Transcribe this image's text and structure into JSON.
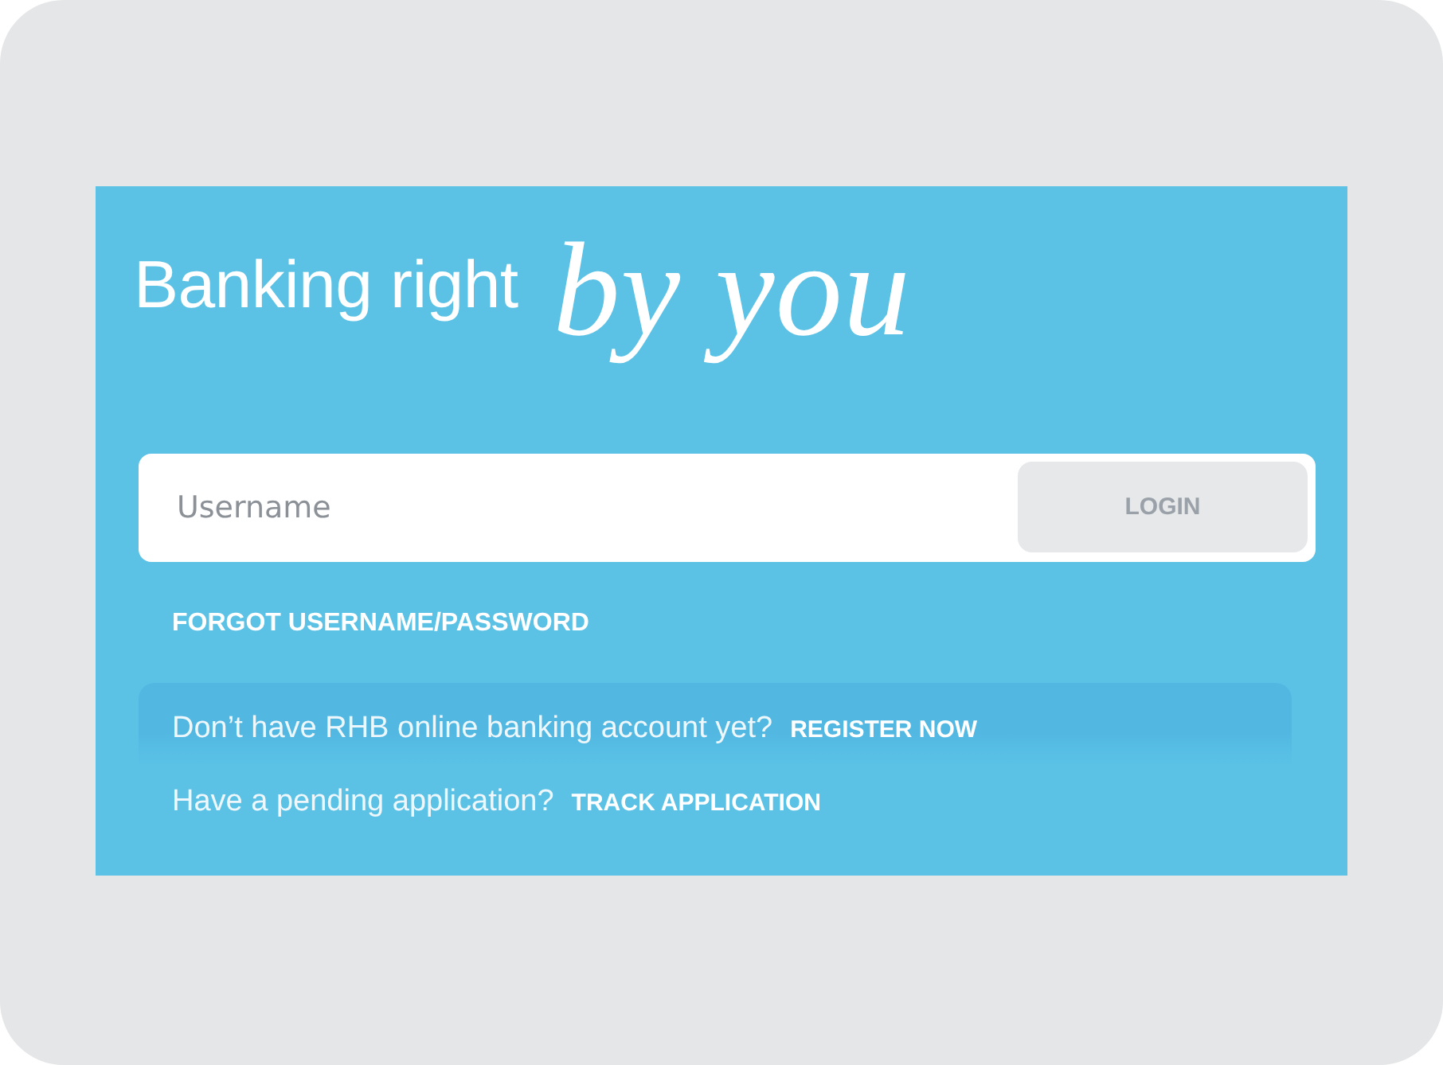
{
  "tagline": {
    "text": "Banking right",
    "script": "by you"
  },
  "login": {
    "placeholder": "Username",
    "button": {
      "label": "LOGIN",
      "disabled": true
    }
  },
  "forgot_link": "FORGOT USERNAME/PASSWORD",
  "prompts": [
    {
      "question": "Don’t have RHB online banking account yet?",
      "link": "REGISTER NOW"
    },
    {
      "question": "Have a pending application?",
      "link": "TRACK APPLICATION"
    }
  ]
}
